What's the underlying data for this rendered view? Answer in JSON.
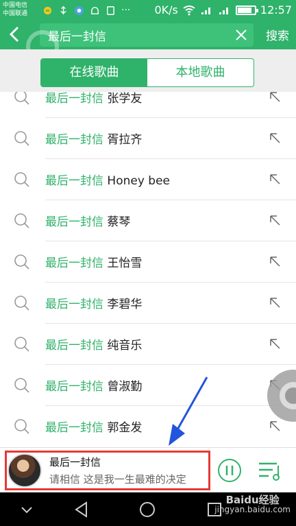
{
  "status_bar": {
    "carrier_1": "中国电信",
    "carrier_2": "中国联通",
    "speed": "0K/s",
    "time": "12:57",
    "battery_level": 0.85
  },
  "header": {
    "search_value": "最后一封信",
    "search_button": "搜索"
  },
  "tabs": [
    {
      "label": "在线歌曲",
      "active": true
    },
    {
      "label": "本地歌曲",
      "active": false
    }
  ],
  "suggestions": [
    {
      "keyword": "最后一封信",
      "suffix": "张学友"
    },
    {
      "keyword": "最后一封信",
      "suffix": "胥拉齐"
    },
    {
      "keyword": "最后一封信",
      "suffix": "Honey bee"
    },
    {
      "keyword": "最后一封信",
      "suffix": "蔡琴"
    },
    {
      "keyword": "最后一封信",
      "suffix": "王怡雪"
    },
    {
      "keyword": "最后一封信",
      "suffix": "李碧华"
    },
    {
      "keyword": "最后一封信",
      "suffix": "纯音乐"
    },
    {
      "keyword": "最后一封信",
      "suffix": "曾淑勤"
    },
    {
      "keyword": "最后一封信",
      "suffix": "郭金发"
    }
  ],
  "player": {
    "title": "最后一封信",
    "lyric": "请相信 这是我一生最难的决定"
  },
  "watermark": {
    "brand": "Baidu经验",
    "url": "jingyan.baidu.com"
  },
  "colors": {
    "accent": "#2fb26a",
    "highlight_box": "#e53935",
    "annotation_arrow": "#2255dd"
  }
}
